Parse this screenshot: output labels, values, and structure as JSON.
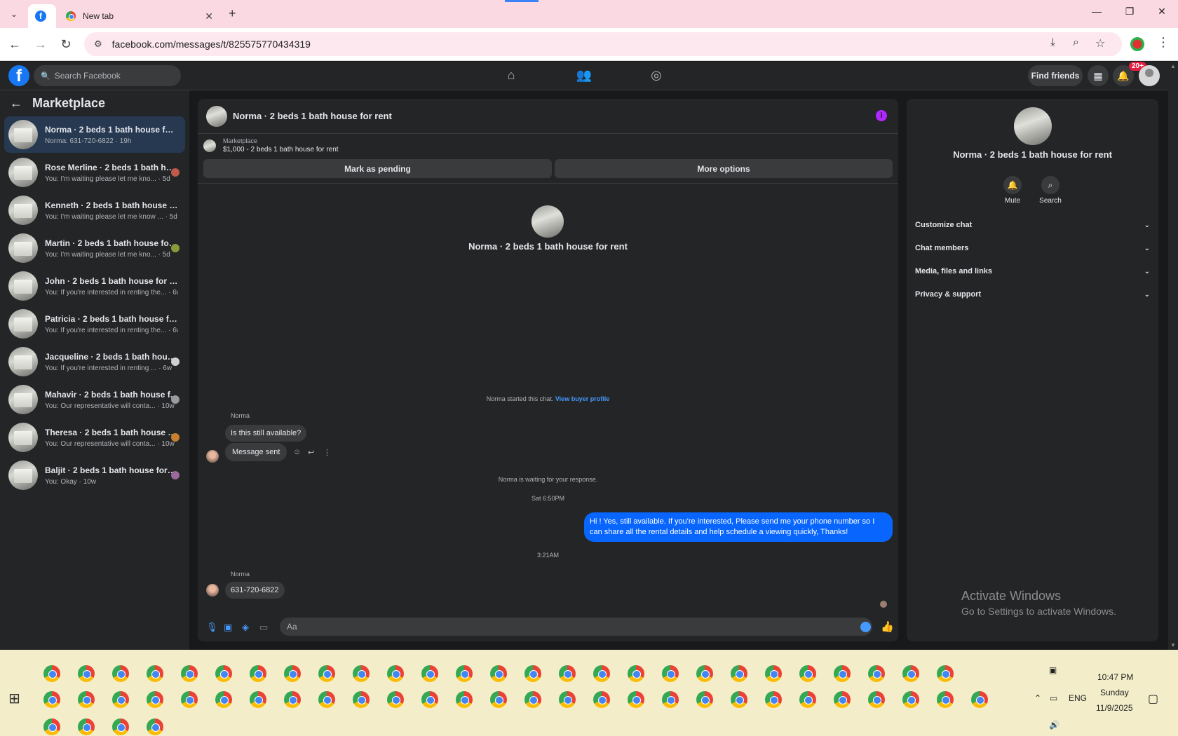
{
  "browser": {
    "tabs": [
      {
        "label": "",
        "icon": "facebook-icon",
        "active": true
      },
      {
        "label": "New tab",
        "icon": "chrome-icon",
        "active": false
      }
    ],
    "url": "facebook.com/messages/t/825575770434319"
  },
  "fb_header": {
    "search_placeholder": "Search Facebook",
    "find_friends_label": "Find friends",
    "notification_count": "20+"
  },
  "sidebar": {
    "title": "Marketplace",
    "conversations": [
      {
        "title": "Norma · 2 beds 1 bath house for re...",
        "snippet": "Norma: 631-720-6822 · 19h",
        "selected": true
      },
      {
        "title": "Rose Merline · 2 beds 1 bath ho...",
        "snippet": "You: I'm waiting please let me kno... · 5d"
      },
      {
        "title": "Kenneth · 2 beds 1 bath house for ...",
        "snippet": "You: I'm waiting please let me know ... · 5d"
      },
      {
        "title": "Martin · 2 beds 1 bath house for...",
        "snippet": "You: I'm waiting please let me kno... · 5d"
      },
      {
        "title": "John · 2 beds 1 bath house for rent",
        "snippet": "You: If you're interested in renting the... · 6w"
      },
      {
        "title": "Patricia · 2 beds 1 bath house for r...",
        "snippet": "You: If you're interested in renting the... · 6w"
      },
      {
        "title": "Jacqueline · 2 beds 1 bath house...",
        "snippet": "You: If you're interested in renting ... · 6w"
      },
      {
        "title": "Mahavir · 2 beds 1 bath house f...",
        "snippet": "You: Our representative will conta... · 10w"
      },
      {
        "title": "Theresa · 2 beds 1 bath house fo...",
        "snippet": "You: Our representative will conta... · 10w"
      },
      {
        "title": "Baljit · 2 beds 1 bath house for r...",
        "snippet": "You: Okay · 10w"
      }
    ]
  },
  "chat": {
    "title": "Norma · 2 beds 1 bath house for rent",
    "marketplace_label": "Marketplace",
    "listing": "$1,000 - 2 beds 1 bath house for rent",
    "mark_pending_label": "Mark as pending",
    "more_options_label": "More options",
    "center_name": "Norma · 2 beds 1 bath house for rent",
    "started_text": "Norma started this chat.",
    "view_profile_label": "View buyer profile",
    "sender_name": "Norma",
    "msg1": "Is this still available?",
    "msg2": "Message sent",
    "waiting_text": "Norma is waiting for your response.",
    "ts1": "Sat 6:50PM",
    "outgoing": "Hi ! Yes, still available. If you're interested, Please send me your phone number so I can share all the rental details and help schedule a viewing quickly, Thanks!",
    "ts2": "3:21AM",
    "msg3": "631-720-6822",
    "composer_placeholder": "Aa"
  },
  "details": {
    "name": "Norma · 2 beds 1 bath house for rent",
    "mute_label": "Mute",
    "search_label": "Search",
    "sections": [
      "Customize chat",
      "Chat members",
      "Media, files and links",
      "Privacy & support"
    ]
  },
  "watermark": {
    "line1": "Activate Windows",
    "line2": "Go to Settings to activate Windows."
  },
  "taskbar": {
    "lang": "ENG",
    "time": "10:47 PM",
    "day": "Sunday",
    "date": "11/9/2025"
  },
  "colors": {
    "accent": "#0866ff",
    "link": "#4599ff",
    "info": "#b026ff",
    "badge": "#e41e3f"
  }
}
